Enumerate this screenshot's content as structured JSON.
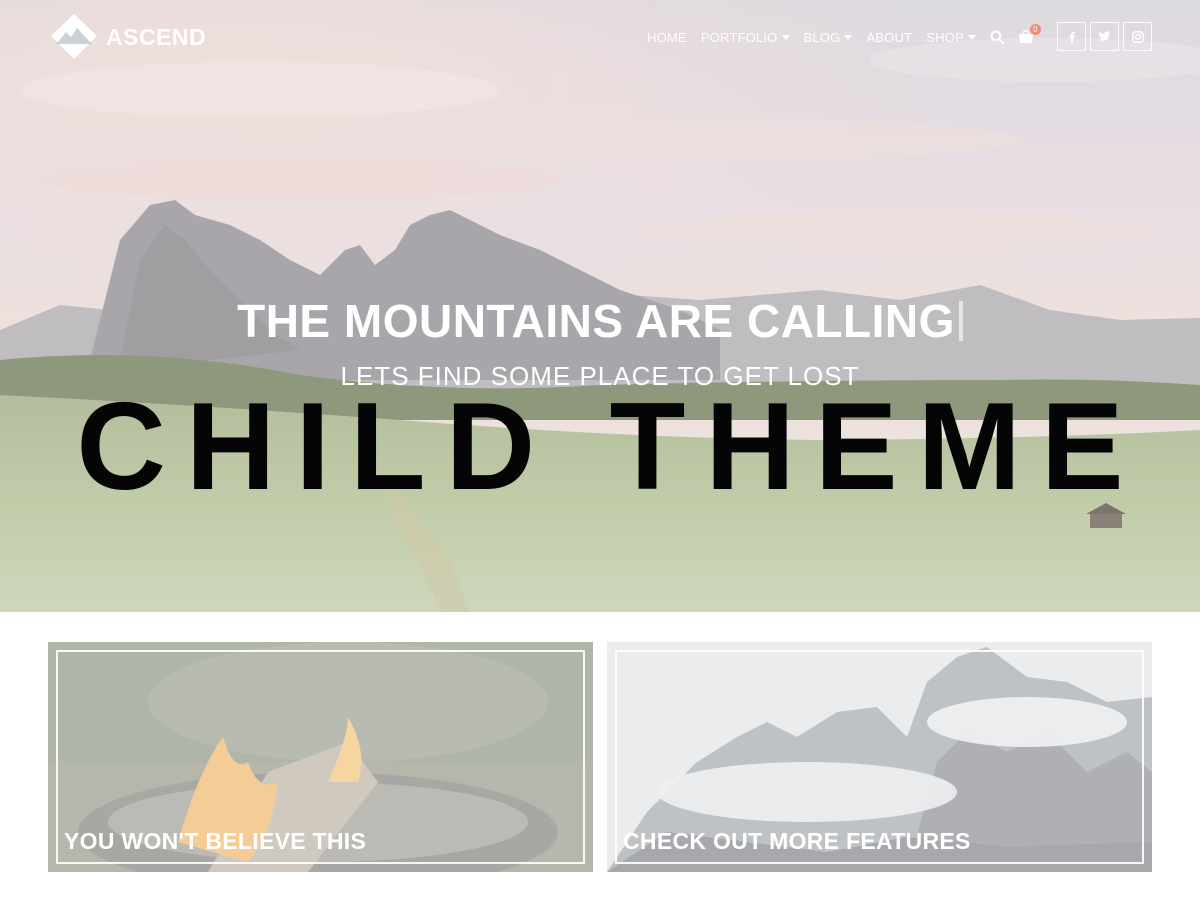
{
  "brand": {
    "name": "ASCEND",
    "logo_icon": "mountain-diamond-icon"
  },
  "nav": {
    "items": [
      {
        "label": "HOME",
        "dropdown": false
      },
      {
        "label": "PORTFOLIO",
        "dropdown": true
      },
      {
        "label": "BLOG",
        "dropdown": true
      },
      {
        "label": "ABOUT",
        "dropdown": false
      },
      {
        "label": "SHOP",
        "dropdown": true
      }
    ],
    "search_icon": "search-icon",
    "cart_icon": "cart-icon",
    "cart_count": "0"
  },
  "social": [
    {
      "icon": "facebook-icon",
      "glyph": "f"
    },
    {
      "icon": "twitter-icon",
      "glyph": "t"
    },
    {
      "icon": "instagram-icon",
      "glyph": "ig"
    }
  ],
  "hero": {
    "title": "THE MOUNTAINS ARE CALLING",
    "subtitle": "LETS FIND SOME PLACE TO GET LOST",
    "big_text": "CHILD THEME"
  },
  "cards": [
    {
      "label": "YOU WON'T BELIEVE THIS"
    },
    {
      "label": "CHECK OUT MORE FEATURES"
    }
  ],
  "colors": {
    "badge": "#f08b7a",
    "hero_big_text": "#050505",
    "text_light": "#ffffff"
  }
}
